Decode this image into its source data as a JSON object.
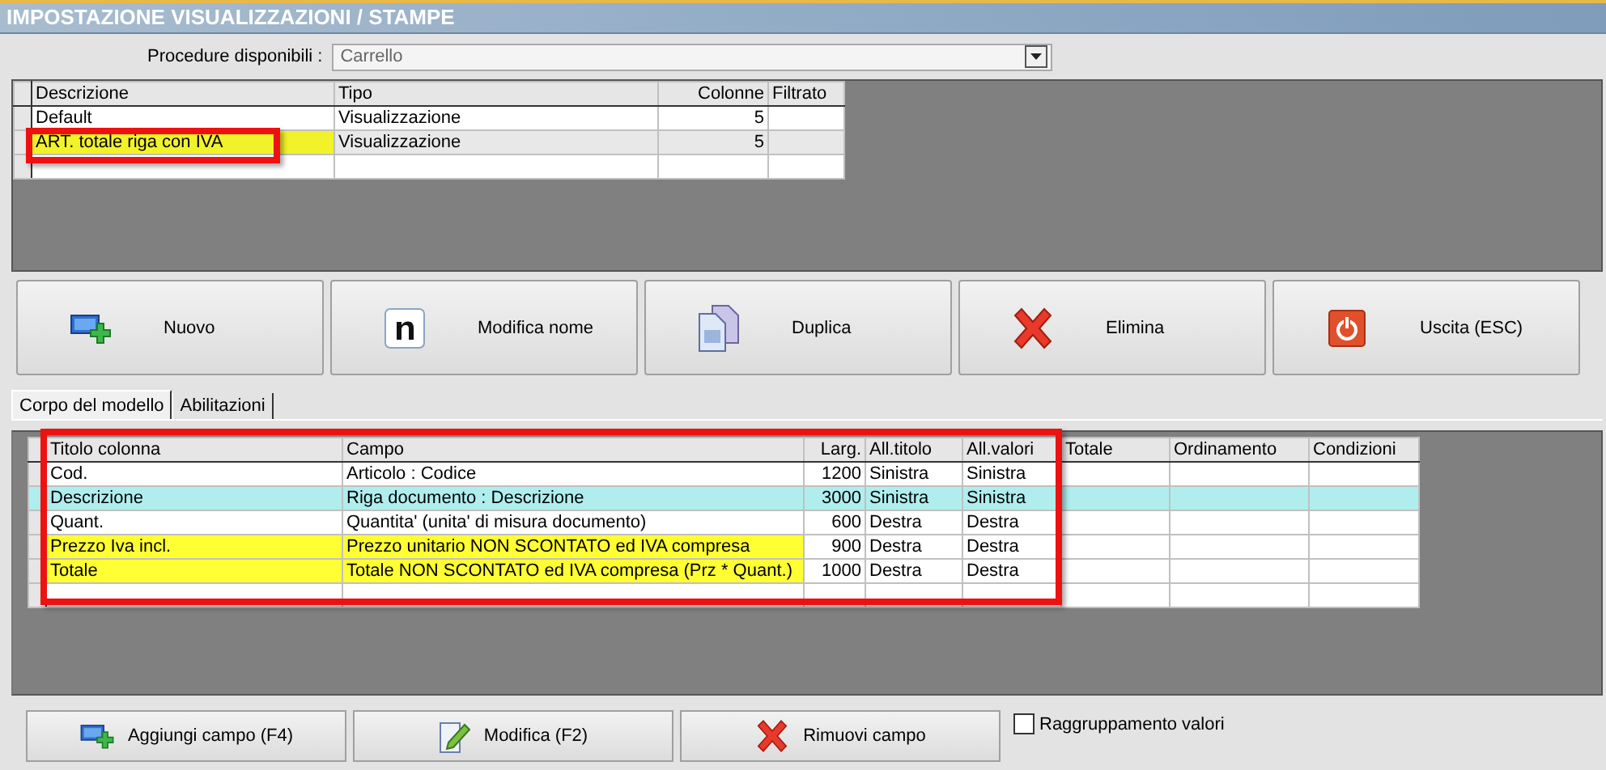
{
  "window": {
    "title": "IMPOSTAZIONE VISUALIZZAZIONI / STAMPE"
  },
  "procedure": {
    "label": "Procedure disponibili :",
    "value": "Carrello"
  },
  "views_table": {
    "columns": [
      {
        "label": "Descrizione"
      },
      {
        "label": "Tipo"
      },
      {
        "label": "Colonne"
      },
      {
        "label": "Filtrato"
      }
    ],
    "rows": [
      {
        "cells": [
          "Default",
          "Visualizzazione",
          "5",
          ""
        ],
        "selected": false,
        "highlighted": false,
        "boxed": false
      },
      {
        "cells": [
          "ART. totale riga con IVA",
          "Visualizzazione",
          "5",
          ""
        ],
        "selected": true,
        "highlighted": true,
        "boxed": true
      },
      {
        "cells": [
          "",
          "",
          "",
          ""
        ],
        "selected": false,
        "highlighted": false,
        "boxed": false
      }
    ]
  },
  "actions": [
    {
      "label": "Nuovo",
      "kind": "add"
    },
    {
      "label": "Modifica nome",
      "kind": "rename"
    },
    {
      "label": "Duplica",
      "kind": "copy"
    },
    {
      "label": "Elimina",
      "kind": "delete"
    },
    {
      "label": "Uscita (ESC)",
      "kind": "exit"
    }
  ],
  "tabs": [
    {
      "label": "Corpo del modello",
      "selected": true
    },
    {
      "label": "Abilitazioni",
      "selected": false
    }
  ],
  "fields_table": {
    "boxed": true,
    "columns": [
      {
        "label": "Titolo colonna"
      },
      {
        "label": "Campo"
      },
      {
        "label": "Larg."
      },
      {
        "label": "All.titolo"
      },
      {
        "label": "All.valori"
      },
      {
        "label": "Totale"
      },
      {
        "label": "Ordinamento"
      },
      {
        "label": "Condizioni"
      }
    ],
    "rows": [
      {
        "cells": [
          "Cod.",
          "Articolo : Codice",
          "1200",
          "Sinistra",
          "Sinistra",
          "",
          "",
          ""
        ],
        "selected": false,
        "highlighted": false
      },
      {
        "cells": [
          "Descrizione",
          "Riga documento : Descrizione",
          "3000",
          "Sinistra",
          "Sinistra",
          "",
          "",
          ""
        ],
        "selected": true,
        "highlighted": false
      },
      {
        "cells": [
          "Quant.",
          "Quantita' (unita' di misura documento)",
          "600",
          "Destra",
          "Destra",
          "",
          "",
          ""
        ],
        "selected": false,
        "highlighted": false
      },
      {
        "cells": [
          "Prezzo Iva incl.",
          "Prezzo unitario NON SCONTATO ed IVA compresa",
          "900",
          "Destra",
          "Destra",
          "",
          "",
          ""
        ],
        "selected": false,
        "highlighted": true
      },
      {
        "cells": [
          "Totale",
          "Totale NON SCONTATO ed IVA compresa (Prz * Quant.)",
          "1000",
          "Destra",
          "Destra",
          "",
          "",
          ""
        ],
        "selected": false,
        "highlighted": true
      },
      {
        "cells": [
          "",
          "",
          "",
          "",
          "",
          "",
          "",
          ""
        ],
        "selected": false,
        "highlighted": false
      }
    ]
  },
  "bottom_actions": [
    {
      "label": "Aggiungi campo (F4)",
      "kind": "add"
    },
    {
      "label": "Modifica (F2)",
      "kind": "edit"
    },
    {
      "label": "Rimuovi campo",
      "kind": "delete"
    }
  ],
  "grouping": {
    "label": "Raggruppamento valori",
    "checked": false
  }
}
